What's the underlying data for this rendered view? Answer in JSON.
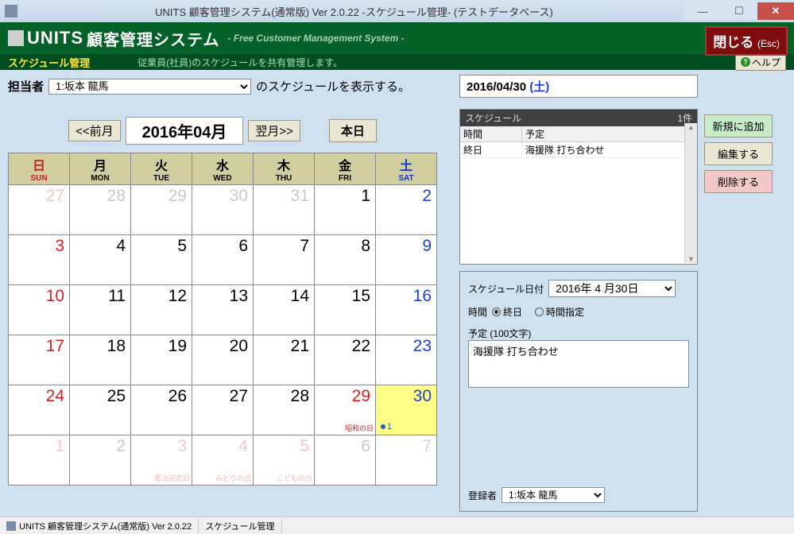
{
  "window": {
    "title": "UNITS 顧客管理システム(通常版)  Ver 2.0.22 -スケジュール管理- (テストデータベース)"
  },
  "header": {
    "brand": "UNITS",
    "brand_jp": "顧客管理システム",
    "subtitle": "- Free Customer Management System -",
    "close_label": "閉じる",
    "close_esc": "(Esc)"
  },
  "subheader": {
    "section": "スケジュール管理",
    "desc": "従業員(社員)のスケジュールを共有管理します。",
    "help_label": "ヘルプ"
  },
  "person": {
    "label": "担当者",
    "value": "1:坂本 龍馬",
    "suffix": "のスケジュールを表示する。"
  },
  "nav": {
    "prev": "<<前月",
    "month": "2016年04月",
    "next": "翌月>>",
    "today": "本日"
  },
  "weekdays": [
    {
      "jp": "日",
      "en": "SUN",
      "cls": "sun"
    },
    {
      "jp": "月",
      "en": "MON",
      "cls": ""
    },
    {
      "jp": "火",
      "en": "TUE",
      "cls": ""
    },
    {
      "jp": "水",
      "en": "WED",
      "cls": ""
    },
    {
      "jp": "木",
      "en": "THU",
      "cls": ""
    },
    {
      "jp": "金",
      "en": "FRI",
      "cls": ""
    },
    {
      "jp": "土",
      "en": "SAT",
      "cls": "sat"
    }
  ],
  "days": [
    {
      "n": "27",
      "cls": "other sun"
    },
    {
      "n": "28",
      "cls": "other"
    },
    {
      "n": "29",
      "cls": "other"
    },
    {
      "n": "30",
      "cls": "other"
    },
    {
      "n": "31",
      "cls": "other"
    },
    {
      "n": "1",
      "cls": ""
    },
    {
      "n": "2",
      "cls": "sat"
    },
    {
      "n": "3",
      "cls": "sun"
    },
    {
      "n": "4",
      "cls": ""
    },
    {
      "n": "5",
      "cls": ""
    },
    {
      "n": "6",
      "cls": ""
    },
    {
      "n": "7",
      "cls": ""
    },
    {
      "n": "8",
      "cls": ""
    },
    {
      "n": "9",
      "cls": "sat"
    },
    {
      "n": "10",
      "cls": "sun"
    },
    {
      "n": "11",
      "cls": ""
    },
    {
      "n": "12",
      "cls": ""
    },
    {
      "n": "13",
      "cls": ""
    },
    {
      "n": "14",
      "cls": ""
    },
    {
      "n": "15",
      "cls": ""
    },
    {
      "n": "16",
      "cls": "sat"
    },
    {
      "n": "17",
      "cls": "sun"
    },
    {
      "n": "18",
      "cls": ""
    },
    {
      "n": "19",
      "cls": ""
    },
    {
      "n": "20",
      "cls": ""
    },
    {
      "n": "21",
      "cls": ""
    },
    {
      "n": "22",
      "cls": ""
    },
    {
      "n": "23",
      "cls": "sat"
    },
    {
      "n": "24",
      "cls": "sun"
    },
    {
      "n": "25",
      "cls": ""
    },
    {
      "n": "26",
      "cls": ""
    },
    {
      "n": "27",
      "cls": ""
    },
    {
      "n": "28",
      "cls": ""
    },
    {
      "n": "29",
      "cls": "hol",
      "holiday": "昭和の日"
    },
    {
      "n": "30",
      "cls": "sat selected",
      "indicator": "1"
    },
    {
      "n": "1",
      "cls": "other sun"
    },
    {
      "n": "2",
      "cls": "other"
    },
    {
      "n": "3",
      "cls": "other hol",
      "holiday": "憲法記念日"
    },
    {
      "n": "4",
      "cls": "other hol",
      "holiday": "みどりの日"
    },
    {
      "n": "5",
      "cls": "other hol",
      "holiday": "こどもの日"
    },
    {
      "n": "6",
      "cls": "other"
    },
    {
      "n": "7",
      "cls": "other sat"
    }
  ],
  "detail": {
    "date": "2016/04/30",
    "dow": "(土)",
    "sched_title": "スケジュール",
    "count": "1件",
    "col_time": "時間",
    "col_plan": "予定",
    "rows": [
      {
        "time": "終日",
        "plan": "海援隊 打ち合わせ"
      }
    ]
  },
  "form": {
    "date_label": "スケジュール日付",
    "date_value": "2016年 4 月30日",
    "time_label": "時間",
    "radio_allday": "終日",
    "radio_timed": "時間指定",
    "plan_label": "予定 (100文字)",
    "plan_value": "海援隊 打ち合わせ",
    "reg_label": "登録者",
    "reg_value": "1:坂本 龍馬"
  },
  "actions": {
    "add": "新規に追加",
    "edit": "編集する",
    "del": "削除する"
  },
  "status": {
    "s1": "UNITS 顧客管理システム(通常版)  Ver 2.0.22",
    "s2": "スケジュール管理"
  }
}
